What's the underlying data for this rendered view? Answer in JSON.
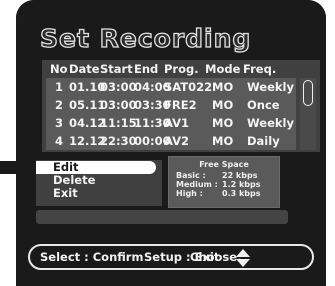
{
  "title": "Set Recording",
  "list": {
    "headers": [
      "No",
      "Date",
      "Start",
      "End",
      "Prog.",
      "Mode",
      "Freq."
    ],
    "rows": [
      {
        "no": "1",
        "date": "01.10",
        "start": "03:00",
        "end": "04:00",
        "prog": "SAT022",
        "mode": "MO",
        "freq": "Weekly"
      },
      {
        "no": "2",
        "date": "05.11",
        "start": "03:00",
        "end": "03:30",
        "prog": "FRE2",
        "mode": "MO",
        "freq": "Once"
      },
      {
        "no": "3",
        "date": "04.12",
        "start": "11:15",
        "end": "11:30",
        "prog": "AV1",
        "mode": "MO",
        "freq": "Weekly"
      },
      {
        "no": "4",
        "date": "12.12",
        "start": "22:30",
        "end": "00:00",
        "prog": "AV2",
        "mode": "MO",
        "freq": "Daily"
      }
    ]
  },
  "menu": {
    "items": [
      "Edit",
      "Delete",
      "Exit"
    ],
    "selected": "Edit"
  },
  "free_space": {
    "title": "Free Space",
    "rows": [
      {
        "label": "Basic :",
        "value": "22 kbps"
      },
      {
        "label": "Medium :",
        "value": "1.2 kbps"
      },
      {
        "label": "High :",
        "value": "0.3 kbps"
      }
    ]
  },
  "help": {
    "select": "Select : Confirm",
    "setup": "Setup : Exit",
    "choose": "Choose:"
  },
  "icons": {
    "choose": "up-down-arrows-icon",
    "scroll": "scrollbar-thumb"
  },
  "colors": {
    "background": "#1a1a1a",
    "panel": "#404040",
    "rows": "#5a5a5a",
    "text": "#f2f2f2",
    "highlight": "#ffffff"
  }
}
